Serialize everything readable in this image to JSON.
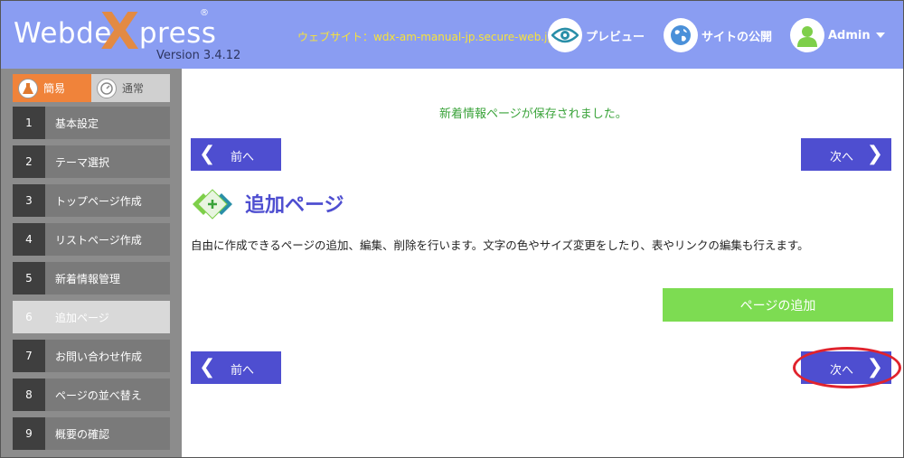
{
  "header": {
    "logo_text_1": "Webde",
    "logo_x": "X",
    "logo_text_2": "press",
    "logo_reg": "®",
    "version": "Version 3.4.12",
    "site_label": "ウェブサイト：wdx-am-manual-jp.secure-web.jp",
    "preview_label": "プレビュー",
    "publish_label": "サイトの公開",
    "admin_label": "Admin",
    "bg_color": "#8a9df2"
  },
  "sidebar": {
    "mode_easy": "簡易",
    "mode_normal": "通常",
    "steps": [
      {
        "num": "1",
        "label": "基本設定"
      },
      {
        "num": "2",
        "label": "テーマ選択"
      },
      {
        "num": "3",
        "label": "トップページ作成"
      },
      {
        "num": "4",
        "label": "リストページ作成"
      },
      {
        "num": "5",
        "label": "新着情報管理"
      },
      {
        "num": "6",
        "label": "追加ページ"
      },
      {
        "num": "7",
        "label": "お問い合わせ作成"
      },
      {
        "num": "8",
        "label": "ページの並べ替え"
      },
      {
        "num": "9",
        "label": "概要の確認"
      }
    ],
    "active_step": "6"
  },
  "main": {
    "saved_message": "新着情報ページが保存されました。",
    "prev_label": "前へ",
    "next_label": "次へ",
    "page_title": "追加ページ",
    "page_description": "自由に作成できるページの追加、編集、削除を行います。文字の色やサイズ変更をしたり、表やリンクの編集も行えます。",
    "add_page_label": "ページの追加",
    "accent_color": "#4e4ed0",
    "add_color": "#7ddc52"
  }
}
